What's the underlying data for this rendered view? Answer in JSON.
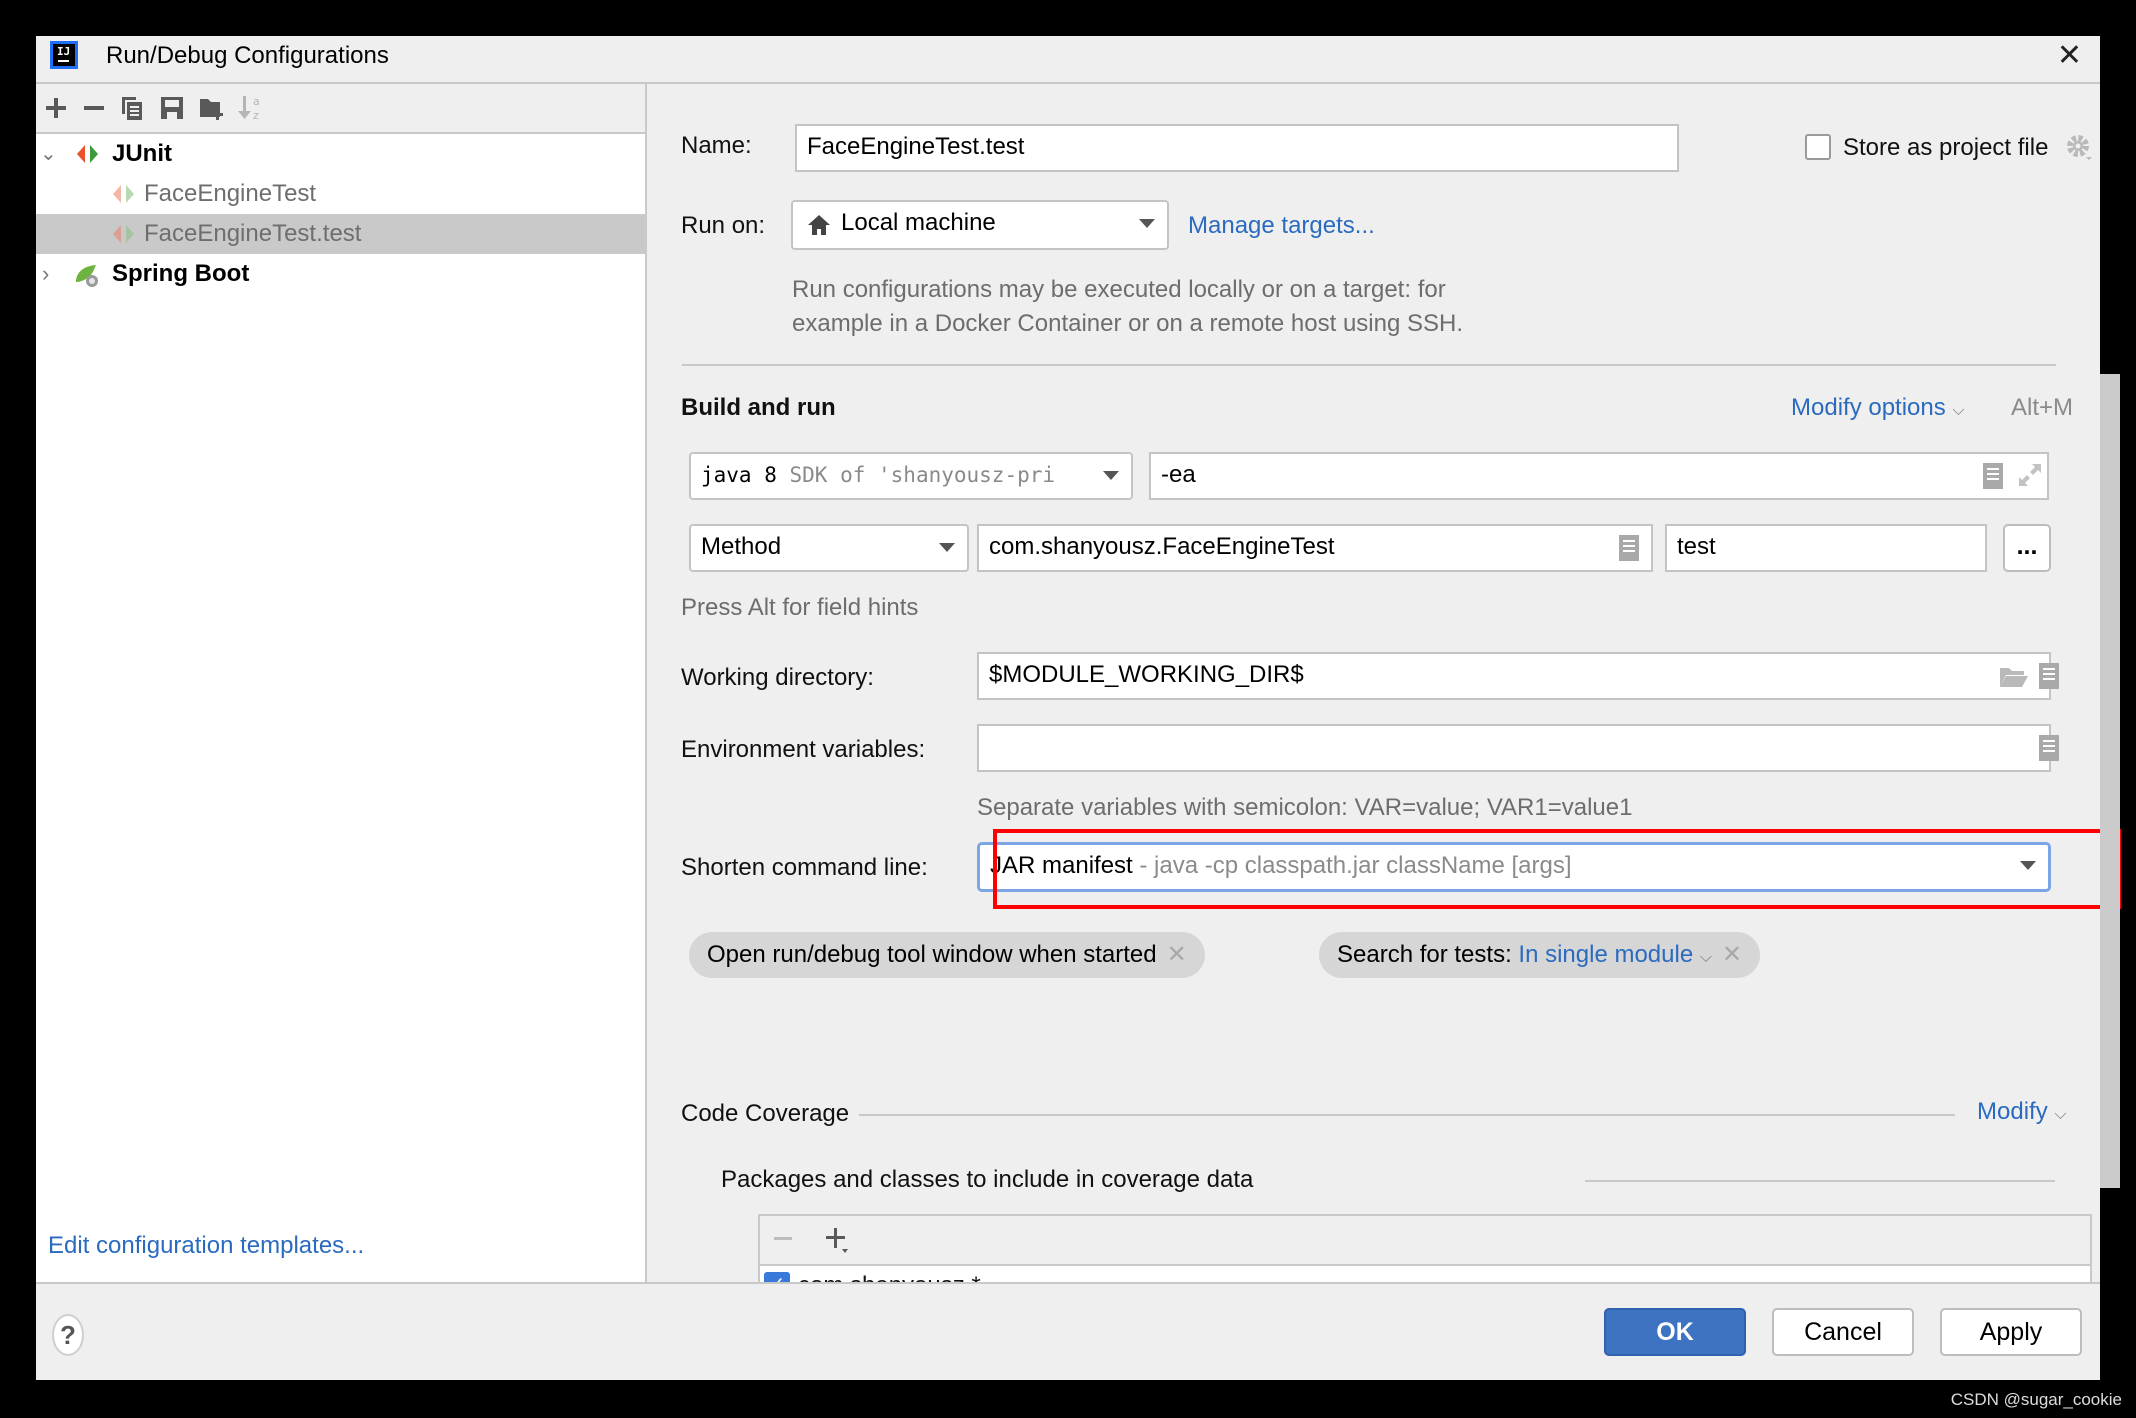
{
  "window": {
    "title": "Run/Debug Configurations",
    "app_icon_text": "IJ"
  },
  "left_toolbar": {
    "icons": [
      "add-icon",
      "remove-icon",
      "copy-icon",
      "save-icon",
      "new-folder-icon",
      "sort-alpha-icon"
    ]
  },
  "tree": {
    "items": [
      {
        "label": "JUnit",
        "expanded": true,
        "bold": true,
        "level": 0
      },
      {
        "label": "FaceEngineTest",
        "level": 1
      },
      {
        "label": "FaceEngineTest.test",
        "level": 1,
        "selected": true
      },
      {
        "label": "Spring Boot",
        "expanded": false,
        "bold": true,
        "level": 0
      }
    ]
  },
  "edit_templates_link": "Edit configuration templates...",
  "form": {
    "name_label": "Name:",
    "name_value": "FaceEngineTest.test",
    "store_as_project_file": {
      "label": "Store as project file",
      "checked": false
    },
    "run_on_label": "Run on:",
    "run_on_value": "Local machine",
    "manage_targets": "Manage targets...",
    "run_on_hint_line1": "Run configurations may be executed locally or on a target: for",
    "run_on_hint_line2": "example in a Docker Container or on a remote host using SSH.",
    "build_and_run_title": "Build and run",
    "modify_options": "Modify options",
    "modify_options_shortcut": "Alt+M",
    "sdk_main": "java 8",
    "sdk_detail": "SDK of 'shanyousz-pri",
    "vm_options": "-ea",
    "test_kind": "Method",
    "class_value": "com.shanyousz.FaceEngineTest",
    "method_value": "test",
    "browse_button": "...",
    "field_hints": "Press Alt for field hints",
    "working_dir_label": "Working directory:",
    "working_dir_value": "$MODULE_WORKING_DIR$",
    "env_label": "Environment variables:",
    "env_value": "",
    "env_hint": "Separate variables with semicolon: VAR=value; VAR1=value1",
    "shorten_label": "Shorten command line:",
    "shorten_value_main": "JAR manifest",
    "shorten_value_detail": " - java -cp classpath.jar className [args]",
    "chips": {
      "open_tool_window": "Open run/debug tool window when started",
      "search_tests_label": "Search for tests: ",
      "search_tests_value": "In single module"
    },
    "code_coverage_title": "Code Coverage",
    "code_coverage_modify": "Modify",
    "packages_title": "Packages and classes to include in coverage data",
    "packages": [
      {
        "pattern": "com.shanyousz.*",
        "checked": true
      }
    ]
  },
  "footer": {
    "help": "?",
    "ok": "OK",
    "cancel": "Cancel",
    "apply": "Apply"
  },
  "watermark": "CSDN @sugar_cookie",
  "colors": {
    "accent": "#2a6bc0",
    "primary_button": "#3d73c0",
    "highlight_box": "#ff0000"
  }
}
